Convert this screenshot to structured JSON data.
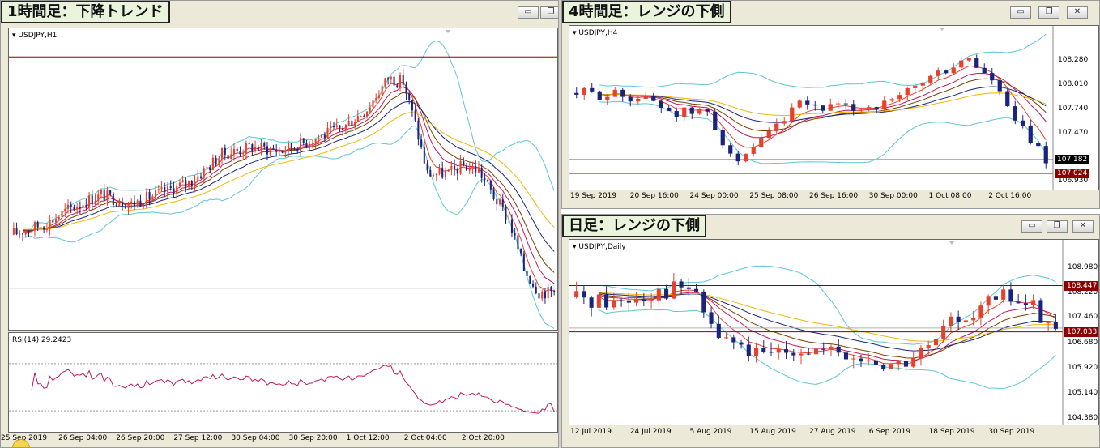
{
  "colors": {
    "bull": "#e8402d",
    "bear": "#1a237e",
    "bands": "#5bc7d4",
    "resistance": "#8b0000",
    "rsi": "#c2185b"
  },
  "window_buttons": {
    "minimize": "▭",
    "restore": "❐",
    "close": "✕"
  },
  "panels": [
    {
      "id": "h1",
      "title": "1時間足：下降トレンド",
      "symbol": "USDJPY,H1",
      "subtitle": "RSI(14) 29.2423",
      "xticks": [
        "25 Sep 2019",
        "26 Sep 04:00",
        "26 Sep 20:00",
        "27 Sep 12:00",
        "30 Sep 04:00",
        "30 Sep 20:00",
        "1 Oct 12:00",
        "2 Oct 04:00",
        "2 Oct 20:00"
      ],
      "yticks": [],
      "price_tags": [],
      "n": 180,
      "chart_data": {
        "type": "candlestick",
        "symbol": "USDJPY",
        "timeframe": "H1",
        "anchors": [
          [
            0,
            107.54
          ],
          [
            12,
            107.6
          ],
          [
            20,
            107.68
          ],
          [
            30,
            107.75
          ],
          [
            40,
            107.7
          ],
          [
            50,
            107.76
          ],
          [
            60,
            107.82
          ],
          [
            70,
            107.96
          ],
          [
            80,
            108.0
          ],
          [
            90,
            107.98
          ],
          [
            100,
            108.04
          ],
          [
            110,
            108.1
          ],
          [
            118,
            108.2
          ],
          [
            125,
            108.36
          ],
          [
            130,
            108.34
          ],
          [
            134,
            108.12
          ],
          [
            138,
            107.86
          ],
          [
            145,
            107.86
          ],
          [
            150,
            107.9
          ],
          [
            155,
            107.88
          ],
          [
            160,
            107.74
          ],
          [
            165,
            107.62
          ],
          [
            170,
            107.36
          ],
          [
            175,
            107.24
          ],
          [
            180,
            107.24
          ]
        ],
        "resistance": 108.47,
        "current": 107.26,
        "ylim": [
          107.06,
          108.56
        ],
        "rsi": {
          "period": 14,
          "value": 29.2423,
          "levels": [
            70,
            30
          ],
          "ylim": [
            15,
            85
          ]
        }
      }
    },
    {
      "id": "h4",
      "title": "4時間足：レンジの下側",
      "symbol": "USDJPY,H4",
      "xticks": [
        "19 Sep 2019",
        "20 Sep 16:00",
        "24 Sep 00:00",
        "25 Sep 08:00",
        "26 Sep 16:00",
        "30 Sep 00:00",
        "1 Oct 08:00",
        "2 Oct 16:00"
      ],
      "yticks": [
        "108.280",
        "108.010",
        "107.740",
        "107.470",
        "106.930"
      ],
      "price_tags": [
        {
          "label": "107.182",
          "color": "#000000"
        },
        {
          "label": "107.024",
          "color": "#8b0000"
        }
      ],
      "n": 62,
      "chart_data": {
        "type": "candlestick",
        "symbol": "USDJPY",
        "timeframe": "H4",
        "anchors": [
          [
            0,
            107.92
          ],
          [
            6,
            107.9
          ],
          [
            10,
            107.86
          ],
          [
            14,
            107.7
          ],
          [
            18,
            107.7
          ],
          [
            22,
            107.1
          ],
          [
            26,
            107.45
          ],
          [
            30,
            107.78
          ],
          [
            36,
            107.74
          ],
          [
            42,
            107.8
          ],
          [
            46,
            108.05
          ],
          [
            52,
            108.3
          ],
          [
            55,
            108.05
          ],
          [
            58,
            107.6
          ],
          [
            62,
            107.18
          ]
        ],
        "resistance": 107.024,
        "current": 107.182,
        "ylim": [
          106.88,
          108.54
        ]
      }
    },
    {
      "id": "d1",
      "title": "日足：レンジの下側",
      "symbol": "USDJPY,Daily",
      "xticks": [
        "12 Jul 2019",
        "24 Jul 2019",
        "5 Aug 2019",
        "15 Aug 2019",
        "27 Aug 2019",
        "6 Sep 2019",
        "18 Sep 2019",
        "30 Sep 2019"
      ],
      "yticks": [
        "108.980",
        "108.220",
        "107.460",
        "106.680",
        "105.920",
        "105.140",
        "104.380"
      ],
      "price_tags": [
        {
          "label": "108.447",
          "color": "#8b0000"
        },
        {
          "label": "107.033",
          "color": "#8b0000"
        }
      ],
      "n": 65,
      "chart_data": {
        "type": "candlestick",
        "symbol": "USDJPY",
        "timeframe": "Daily",
        "anchors": [
          [
            0,
            108.1
          ],
          [
            6,
            107.95
          ],
          [
            12,
            108.3
          ],
          [
            16,
            108.4
          ],
          [
            20,
            106.9
          ],
          [
            26,
            106.2
          ],
          [
            30,
            106.6
          ],
          [
            36,
            106.3
          ],
          [
            40,
            106.1
          ],
          [
            44,
            106.0
          ],
          [
            48,
            106.5
          ],
          [
            52,
            107.5
          ],
          [
            58,
            108.1
          ],
          [
            62,
            107.8
          ],
          [
            65,
            107.1
          ]
        ],
        "levels": [
          108.447,
          107.033
        ],
        "current": 107.15,
        "ylim": [
          104.3,
          109.5
        ]
      }
    }
  ]
}
